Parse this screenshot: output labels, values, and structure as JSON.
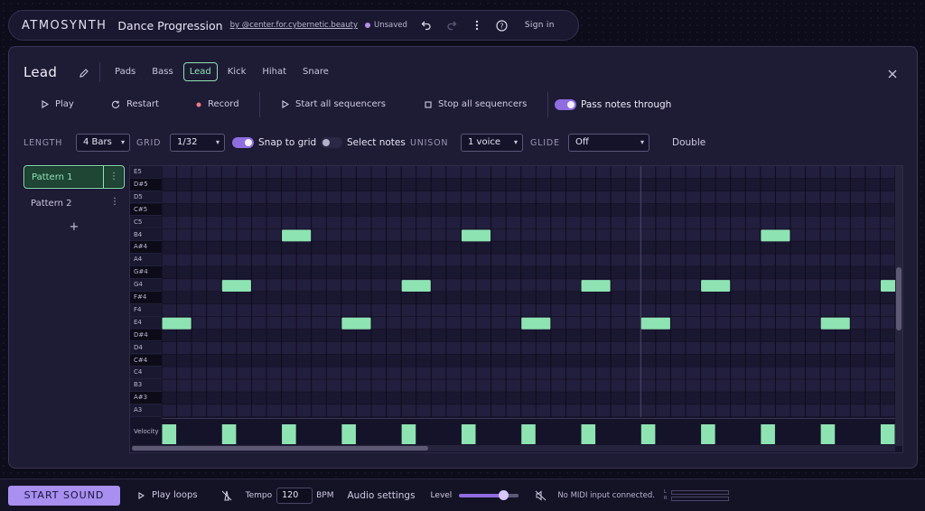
{
  "topbar": {
    "brand": "ATMOSYNTH",
    "song_title": "Dance Progression",
    "byline": "by @center.for.cybernetic.beauty",
    "save_status": "Unsaved",
    "sign_in": "Sign in",
    "icons": [
      "undo-icon",
      "redo-icon",
      "more-vertical-icon",
      "help-icon"
    ]
  },
  "panel": {
    "title": "Lead",
    "instrument_tabs": [
      "Pads",
      "Bass",
      "Lead",
      "Kick",
      "Hihat",
      "Snare"
    ],
    "active_tab": "Lead",
    "transport": {
      "play": "Play",
      "restart": "Restart",
      "record": "Record",
      "start_all": "Start all sequencers",
      "stop_all": "Stop all sequencers",
      "pass_notes": "Pass notes through",
      "pass_notes_on": true
    },
    "options": {
      "length_label": "LENGTH",
      "length_value": "4 Bars",
      "grid_label": "GRID",
      "grid_value": "1/32",
      "snap_to_grid": "Snap to grid",
      "snap_on": true,
      "select_notes": "Select notes",
      "select_on": false,
      "unison_label": "UNISON",
      "unison_value": "1 voice",
      "glide_label": "GLIDE",
      "glide_value": "Off",
      "double": "Double"
    },
    "patterns": [
      {
        "name": "Pattern 1",
        "active": true
      },
      {
        "name": "Pattern 2",
        "active": false
      }
    ],
    "add_pattern": "+"
  },
  "piano_roll": {
    "keys": [
      "E5",
      "D#5",
      "D5",
      "C#5",
      "C5",
      "B4",
      "A#4",
      "A4",
      "G#4",
      "G4",
      "F#4",
      "F4",
      "E4",
      "D#4",
      "D4",
      "C#4",
      "C4",
      "B3",
      "A#3",
      "A3"
    ],
    "velocity_label": "Velocity",
    "notes": [
      {
        "pitch": "E4",
        "step": 0
      },
      {
        "pitch": "G4",
        "step": 4
      },
      {
        "pitch": "B4",
        "step": 8
      },
      {
        "pitch": "E4",
        "step": 12
      },
      {
        "pitch": "G4",
        "step": 16
      },
      {
        "pitch": "B4",
        "step": 20
      },
      {
        "pitch": "E4",
        "step": 24
      },
      {
        "pitch": "G4",
        "step": 28
      },
      {
        "pitch": "E4",
        "step": 32
      },
      {
        "pitch": "G4",
        "step": 36
      },
      {
        "pitch": "B4",
        "step": 40
      },
      {
        "pitch": "E4",
        "step": 44
      },
      {
        "pitch": "G4",
        "step": 48
      }
    ],
    "note_color": "#8ee3b2"
  },
  "bottombar": {
    "start_sound": "START SOUND",
    "play_loops": "Play loops",
    "tempo_label": "Tempo",
    "tempo_value": "120",
    "bpm": "BPM",
    "audio_settings": "Audio settings",
    "level_label": "Level",
    "level": 0.73,
    "midi_status": "No MIDI input connected.",
    "meter_l": "L",
    "meter_r": "R"
  },
  "colors": {
    "accent": "#a88ff0",
    "note": "#8ee3b2",
    "panel": "#1e1b35"
  }
}
